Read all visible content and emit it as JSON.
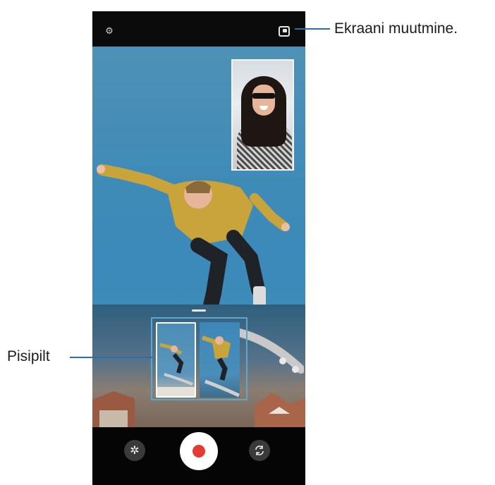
{
  "top_bar": {
    "settings_icon": "gear-icon",
    "view_toggle_icon": "picture-in-picture-icon"
  },
  "controls": {
    "left_icon": "filter-effect-icon",
    "record_icon": "record-icon",
    "right_icon": "switch-camera-icon",
    "record_color": "#e53b33"
  },
  "callouts": {
    "screen_switch": "Ekraani muutmine.",
    "thumbnail": "Pisipilt"
  }
}
